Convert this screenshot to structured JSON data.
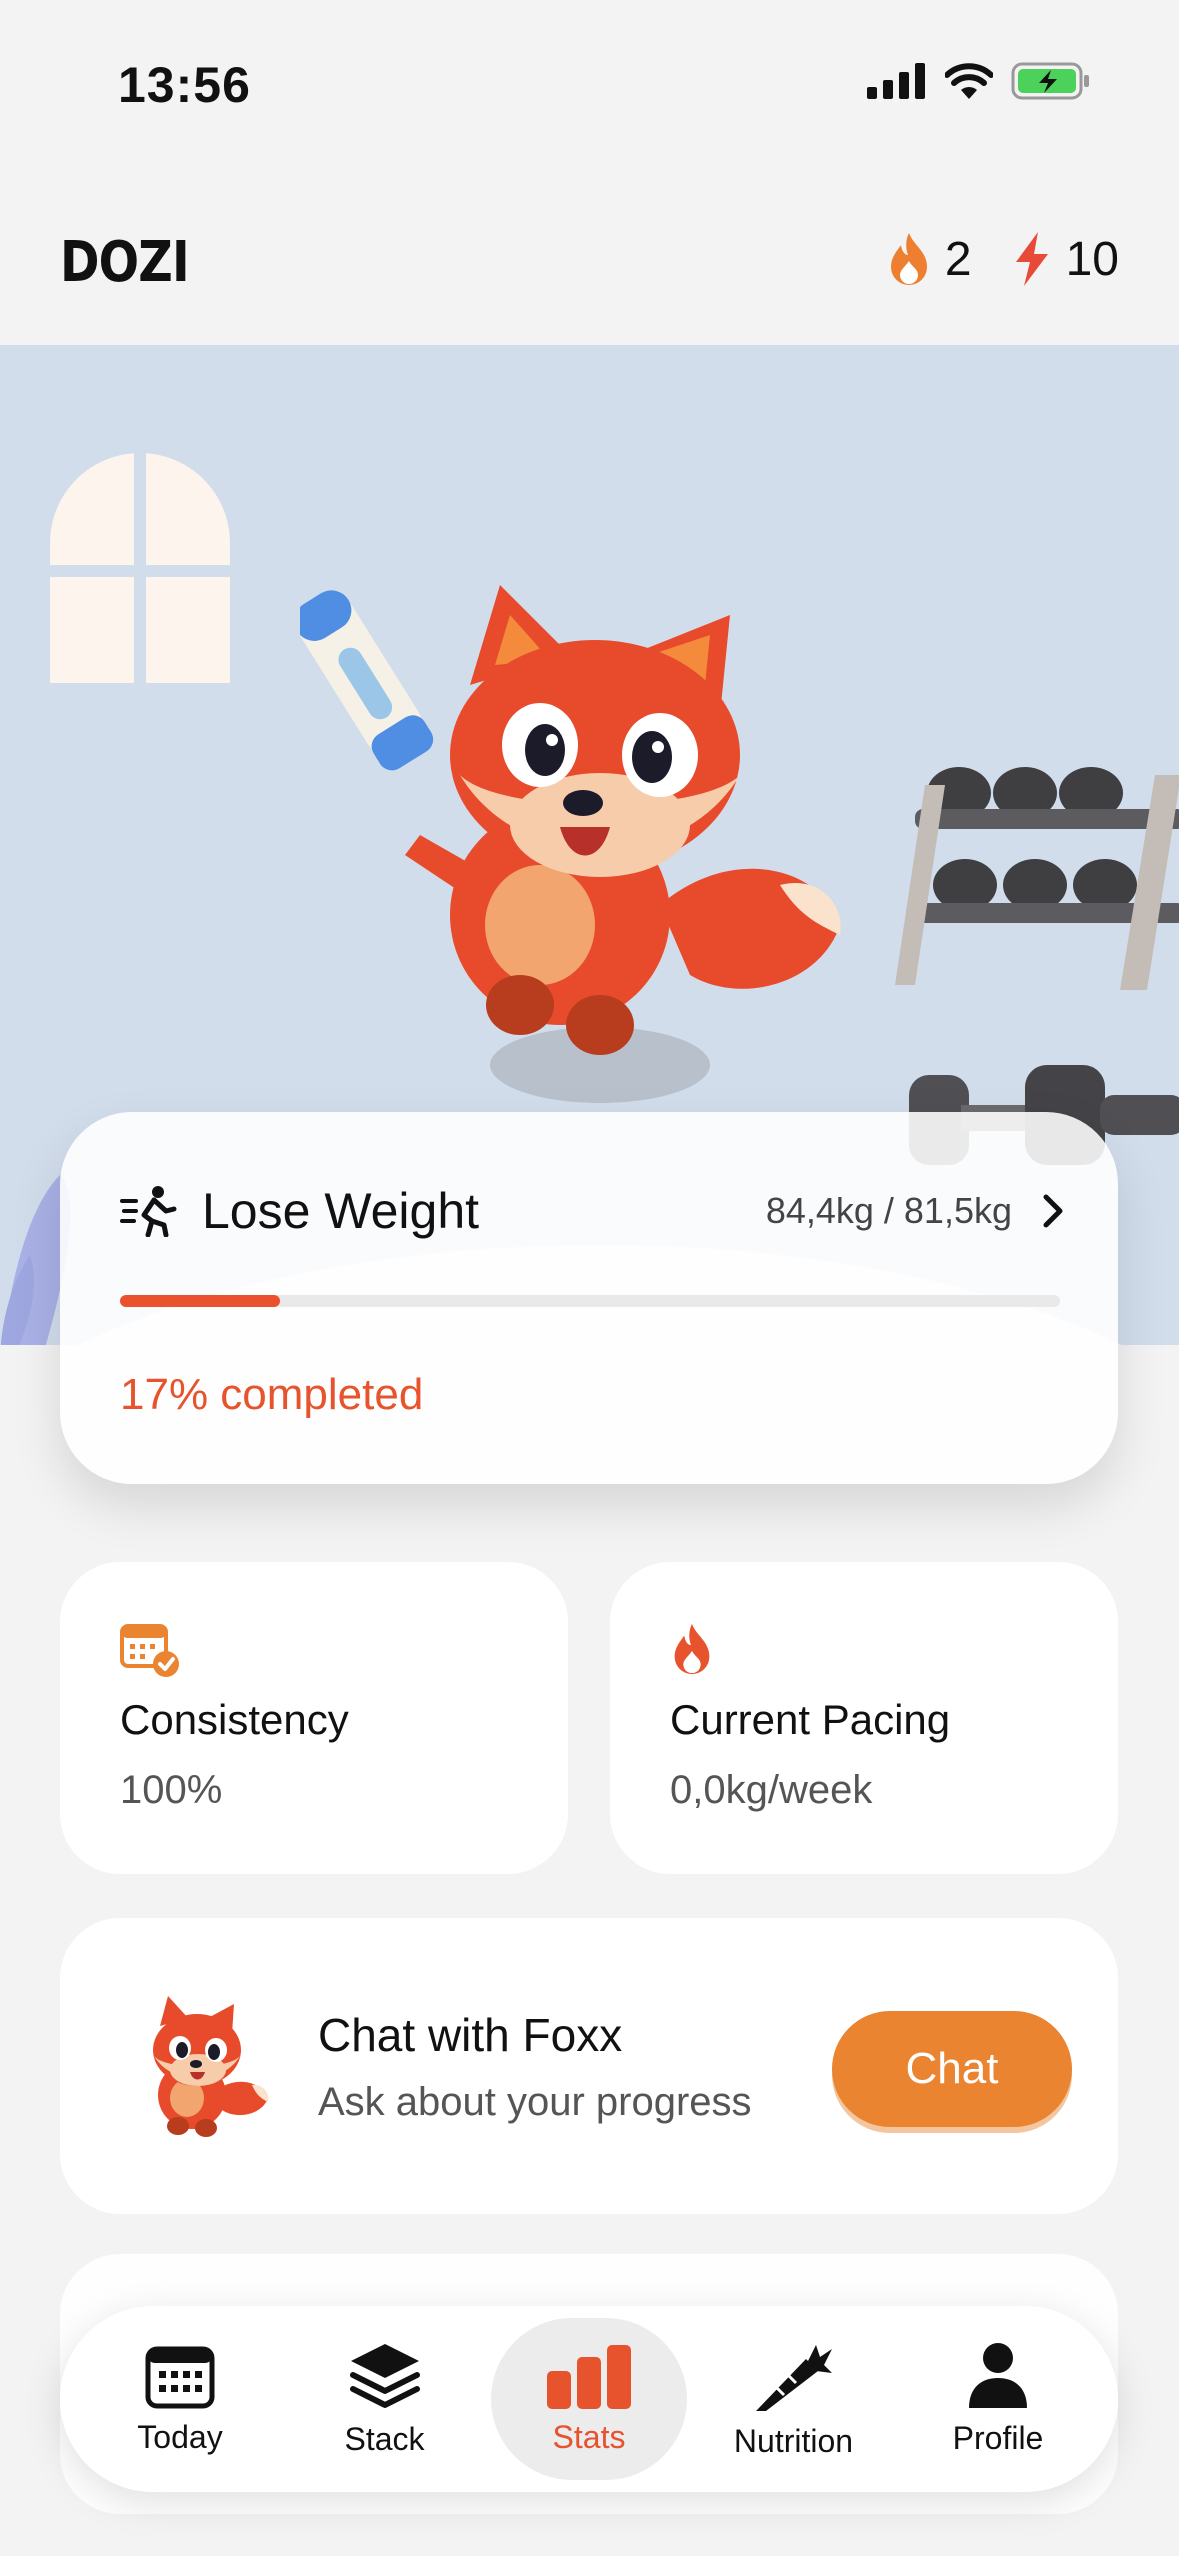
{
  "status_bar": {
    "time": "13:56"
  },
  "header": {
    "logo": "DOZI",
    "streak": {
      "icon": "flame-icon",
      "count": "2"
    },
    "energy": {
      "icon": "lightning-icon",
      "count": "10"
    }
  },
  "goal": {
    "icon": "running-person-icon",
    "title": "Lose Weight",
    "weights": "84,4kg / 81,5kg",
    "progress_percent": 17,
    "completed_label": "17% completed"
  },
  "metrics": [
    {
      "icon": "calendar-check-icon",
      "label": "Consistency",
      "value": "100%"
    },
    {
      "icon": "flame-icon",
      "label": "Current Pacing",
      "value": "0,0kg/week"
    }
  ],
  "chat": {
    "title": "Chat with Foxx",
    "subtitle": "Ask about your progress",
    "button": "Chat"
  },
  "tabs": [
    {
      "icon": "calendar-icon",
      "label": "Today",
      "active": false
    },
    {
      "icon": "layers-icon",
      "label": "Stack",
      "active": false
    },
    {
      "icon": "bar-chart-icon",
      "label": "Stats",
      "active": true
    },
    {
      "icon": "carrot-icon",
      "label": "Nutrition",
      "active": false
    },
    {
      "icon": "person-icon",
      "label": "Profile",
      "active": false
    }
  ],
  "colors": {
    "accent": "#e7532c",
    "chat_button": "#ea8430",
    "hero_background": "#d2ddec",
    "page_background": "#f3f3f3"
  }
}
